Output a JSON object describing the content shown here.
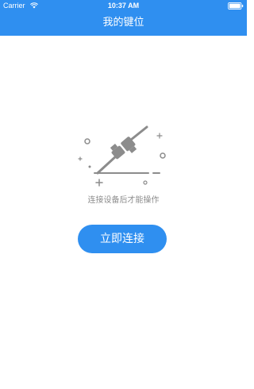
{
  "status_bar": {
    "carrier": "Carrier",
    "time": "10:37 AM",
    "wifi_icon": "wifi-icon",
    "battery_icon": "battery-icon"
  },
  "nav": {
    "title": "我的键位"
  },
  "empty_state": {
    "illustration_icon": "unplugged-cable-icon",
    "hint": "连接设备后才能操作"
  },
  "actions": {
    "connect_label": "立即连接"
  },
  "colors": {
    "accent": "#2f8ff0",
    "hint_text": "#8c8c8c",
    "illustration": "#8c8c8c"
  }
}
